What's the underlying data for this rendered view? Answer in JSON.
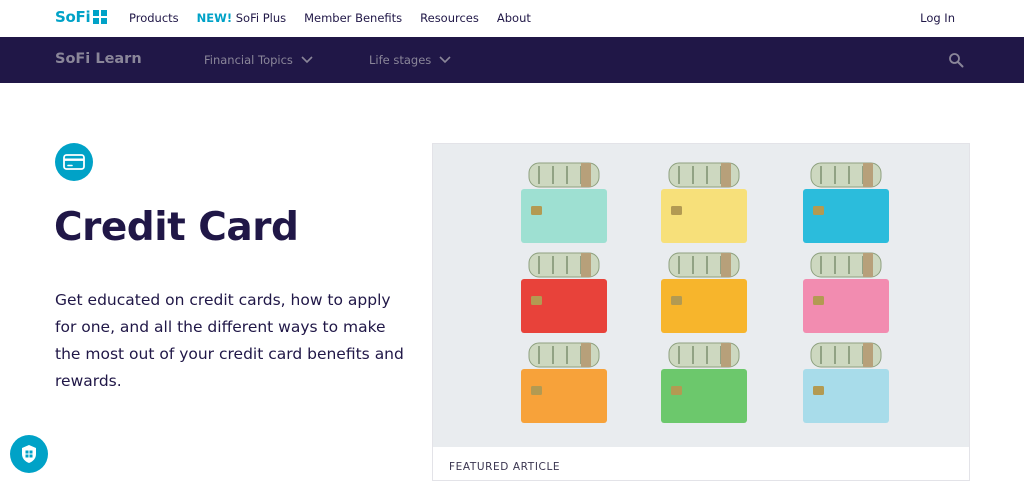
{
  "topnav": {
    "logo": "SoFi",
    "items": [
      "Products",
      "NEW!",
      "SoFi Plus",
      "Member Benefits",
      "Resources",
      "About"
    ],
    "login": "Log In"
  },
  "learnbar": {
    "title": "SoFi Learn",
    "menus": [
      "Financial Topics",
      "Life stages"
    ]
  },
  "hero": {
    "icon": "credit-card-icon",
    "title": "Credit Card",
    "description": "Get educated on credit cards, how to apply for one, and all the different ways to make the most out of your credit card benefits and rewards."
  },
  "featured": {
    "label": "FEATURED ARTICLE",
    "image": "credit-cards-with-rolled-cash-photo"
  },
  "colors": {
    "brand": "#00a2c7",
    "navy": "#201747",
    "cards": [
      "#9ee0d2",
      "#f7e07a",
      "#2bbcdc",
      "#e8423a",
      "#f7b52c",
      "#f28cb0",
      "#f7a23a",
      "#6cc86c",
      "#a8dcea"
    ]
  }
}
